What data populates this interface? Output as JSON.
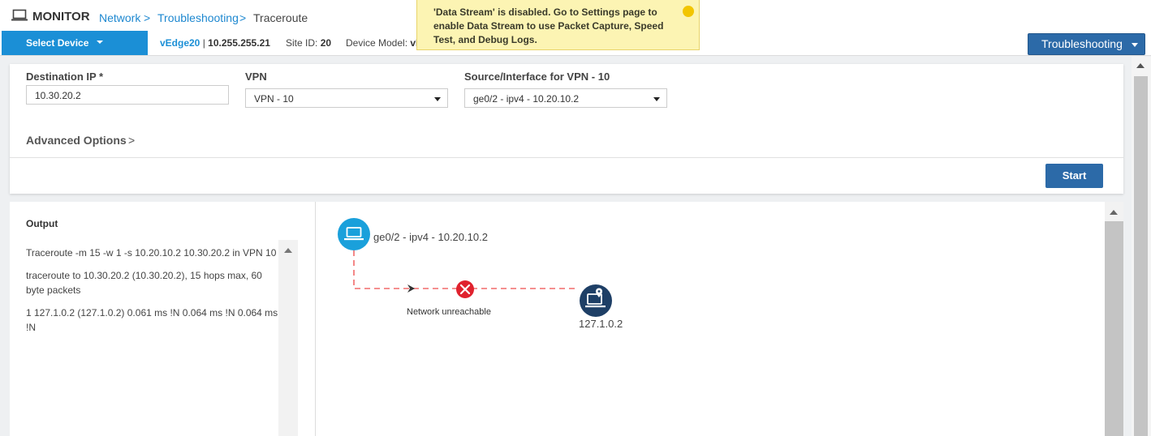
{
  "header": {
    "app_title": "MONITOR",
    "breadcrumb": {
      "network": "Network",
      "troubleshooting": "Troubleshooting",
      "current": "Traceroute",
      "separator": ">"
    }
  },
  "device_bar": {
    "select_device_label": "Select Device",
    "device_name": "vEdge20",
    "separator": "|",
    "device_ip": "10.255.255.21",
    "site_id_label": "Site ID:",
    "site_id_value": "20",
    "device_model_label": "Device Model:",
    "device_model_value": "vE"
  },
  "troubleshooting_button_label": "Troubleshooting",
  "toast": {
    "message": "'Data Stream' is disabled. Go to Settings page to enable Data Stream to use Packet Capture, Speed Test, and Debug Logs."
  },
  "form": {
    "destination_ip_label": "Destination IP *",
    "destination_ip_value": "10.30.20.2",
    "vpn_label": "VPN",
    "vpn_value": "VPN - 10",
    "source_label": "Source/Interface for VPN - 10",
    "source_value": "ge0/2 - ipv4 - 10.20.10.2",
    "advanced_options_label": "Advanced Options",
    "advanced_chevron": ">",
    "start_label": "Start"
  },
  "output": {
    "title": "Output",
    "lines": [
      "Traceroute -m 15 -w 1 -s 10.20.10.2 10.30.20.2 in VPN 10",
      "traceroute to 10.30.20.2 (10.30.20.2), 15 hops max, 60 byte packets",
      "1 127.1.0.2 (127.1.0.2) 0.061 ms !N 0.064 ms !N 0.064 ms !N"
    ]
  },
  "diagram": {
    "source_label": "ge0/2 - ipv4 - 10.20.10.2",
    "error_label": "Network unreachable",
    "destination_label": "127.1.0.2",
    "colors": {
      "source_node": "#1aa0db",
      "destination_node": "#1e3f66",
      "error": "#e0222e",
      "path": "#f26b6b"
    },
    "icons": {
      "source": "laptop-icon",
      "destination": "laptop-pin-icon",
      "error": "x-circle-icon"
    }
  }
}
